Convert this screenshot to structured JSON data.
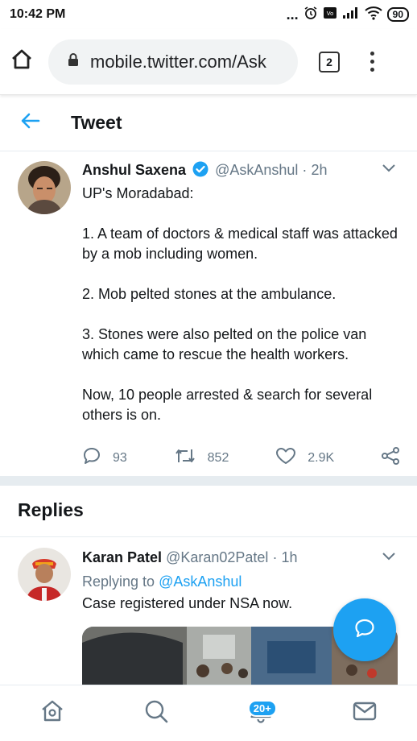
{
  "status_bar": {
    "time": "10:42 PM",
    "dots": "...",
    "battery": "90"
  },
  "browser": {
    "url": "mobile.twitter.com/Ask",
    "tab_count": "2"
  },
  "page": {
    "title": "Tweet"
  },
  "tweet": {
    "author_name": "Anshul Saxena",
    "handle": "@AskAnshul",
    "separator": "·",
    "time": "2h",
    "paragraphs": [
      "UP's Moradabad:",
      "1. A team of doctors & medical staff was attacked by a mob including women.",
      "2. Mob pelted stones at the ambulance.",
      "3. Stones were also pelted on the police van which came to rescue the health workers.",
      "Now, 10 people arrested & search for several others is on."
    ],
    "replies_count": "93",
    "retweets_count": "852",
    "likes_count": "2.9K"
  },
  "replies_section": {
    "heading": "Replies"
  },
  "reply": {
    "author_name": "Karan Patel",
    "handle": "@Karan02Patel",
    "separator": "·",
    "time": "1h",
    "replying_prefix": "Replying to",
    "replying_handle": "@AskAnshul",
    "text": "Case registered under NSA now."
  },
  "bottom_nav": {
    "notifications_badge": "20+"
  },
  "colors": {
    "accent": "#1da1f2",
    "text": "#14171a",
    "muted": "#657786",
    "divider": "#e6ecf0"
  }
}
